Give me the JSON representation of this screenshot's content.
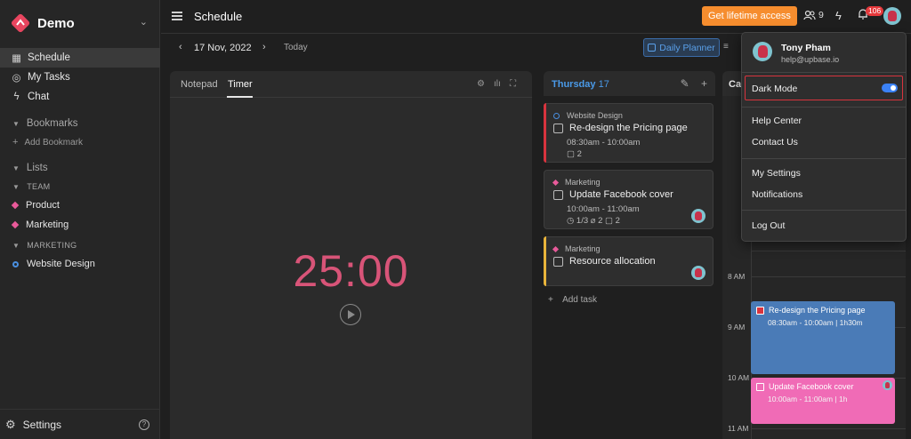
{
  "sidebar": {
    "workspace": "Demo",
    "nav": [
      "Schedule",
      "My Tasks",
      "Chat"
    ],
    "bookmarks_title": "Bookmarks",
    "add_bookmark": "Add Bookmark",
    "lists_title": "Lists",
    "team_label": "TEAM",
    "team_lists": [
      "Product",
      "Marketing"
    ],
    "marketing_label": "MARKETING",
    "marketing_lists": [
      "Website Design"
    ],
    "settings": "Settings",
    "help": "?"
  },
  "topbar": {
    "title": "Schedule",
    "lifetime_button": "Get lifetime access",
    "members_count": "9",
    "notifications_count": "106"
  },
  "datebar": {
    "date": "17 Nov, 2022",
    "today": "Today",
    "planner": "Daily Planner"
  },
  "timer_panel": {
    "tabs": [
      "Notepad",
      "Timer"
    ],
    "active_tab": "Timer",
    "time": "25:00"
  },
  "day": {
    "weekday": "Thursday",
    "day_num": "17",
    "add_task": "Add task",
    "tasks": [
      {
        "list": "Website Design",
        "title": "Re-design the Pricing page",
        "time": "08:30am - 10:00am",
        "meta": "▢ 2"
      },
      {
        "list": "Marketing",
        "title": "Update Facebook cover",
        "time": "10:00am - 11:00am",
        "meta": "◷ 1/3   ⌀ 2   ▢ 2"
      },
      {
        "list": "Marketing",
        "title": "Resource allocation",
        "time": "",
        "meta": ""
      }
    ]
  },
  "calendar": {
    "title": "Ca",
    "hours": [
      "8 AM",
      "9 AM",
      "10 AM",
      "11 AM"
    ],
    "events": [
      {
        "title": "Re-design the Pricing page",
        "time": "08:30am - 10:00am | 1h30m",
        "color": "#4a7bb7"
      },
      {
        "title": "Update Facebook cover",
        "time": "10:00am - 11:00am | 1h",
        "color": "#f06bb6"
      }
    ]
  },
  "menu": {
    "name": "Tony Pham",
    "email": "help@upbase.io",
    "dark_mode": "Dark Mode",
    "dark_mode_on": true,
    "items": [
      "Help Center",
      "Contact Us",
      "My Settings",
      "Notifications",
      "Log Out"
    ]
  },
  "colors": {
    "accent": "#4a9ae8",
    "lifetime": "#f68d2e",
    "timer": "#d85478",
    "marketing": "#e85a9a",
    "website_design": "#4a8fe0"
  }
}
